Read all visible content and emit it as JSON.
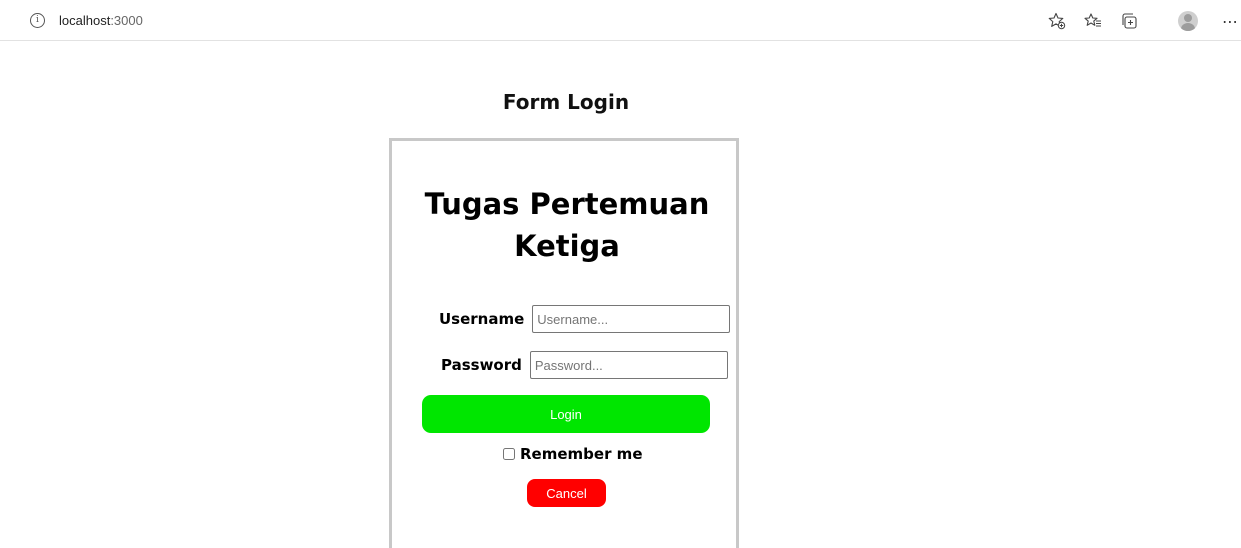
{
  "browser": {
    "url_host": "localhost",
    "url_port": ":3000",
    "info_icon": "i",
    "icons": [
      "favorite-add-icon",
      "favorites-icon",
      "collections-icon",
      "profile-avatar-icon",
      "more-options-icon"
    ],
    "more_glyph": "⋯"
  },
  "page": {
    "title": "Form Login"
  },
  "card": {
    "title_line1": "Tugas Pertemuan",
    "title_line2": "Ketiga",
    "username": {
      "label": "Username",
      "placeholder": "Username...",
      "value": ""
    },
    "password": {
      "label": "Password",
      "placeholder": "Password...",
      "value": ""
    },
    "login_label": "Login",
    "remember_label": "Remember me",
    "remember_checked": false,
    "cancel_label": "Cancel"
  },
  "colors": {
    "login_button": "#00e600",
    "cancel_button": "#ff0000",
    "card_border": "#c8c8c8"
  }
}
